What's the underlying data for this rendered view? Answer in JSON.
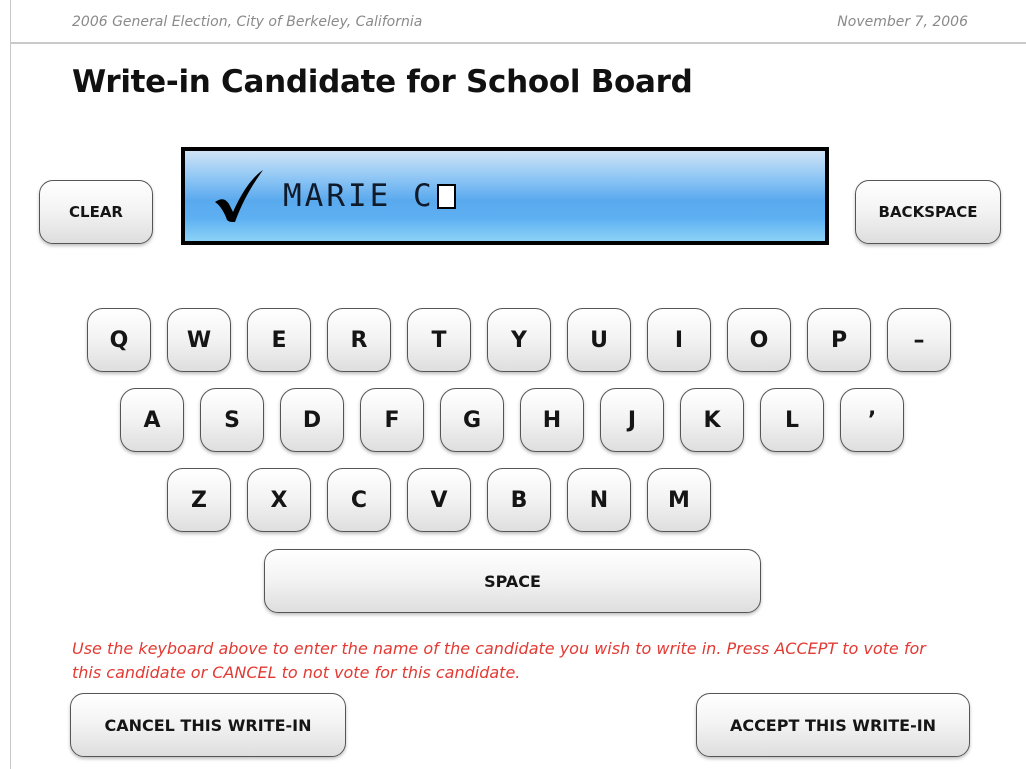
{
  "header": {
    "election": "2006 General Election, City of Berkeley, California",
    "date": "November 7, 2006"
  },
  "title": "Write-in Candidate for School Board",
  "display": {
    "entered_text": "MARIE C",
    "check_icon": "checkmark-icon",
    "cursor_icon": "text-cursor-box"
  },
  "buttons": {
    "clear": "CLEAR",
    "backspace": "BACKSPACE",
    "space": "SPACE",
    "cancel": "CANCEL THIS WRITE-IN",
    "accept": "ACCEPT THIS WRITE-IN"
  },
  "keyboard": {
    "row1": [
      "Q",
      "W",
      "E",
      "R",
      "T",
      "Y",
      "U",
      "I",
      "O",
      "P",
      "–"
    ],
    "row2": [
      "A",
      "S",
      "D",
      "F",
      "G",
      "H",
      "J",
      "K",
      "L",
      "’"
    ],
    "row3": [
      "Z",
      "X",
      "C",
      "V",
      "B",
      "N",
      "M"
    ]
  },
  "instructions": "Use the keyboard above to enter the name of the candidate you wish to write in.  Press ACCEPT to vote for this candidate or CANCEL to not vote for this candidate.",
  "colors": {
    "instruction_text": "#e23a33",
    "display_blue": "#5aa9ee",
    "header_text": "#8a8a8a"
  }
}
